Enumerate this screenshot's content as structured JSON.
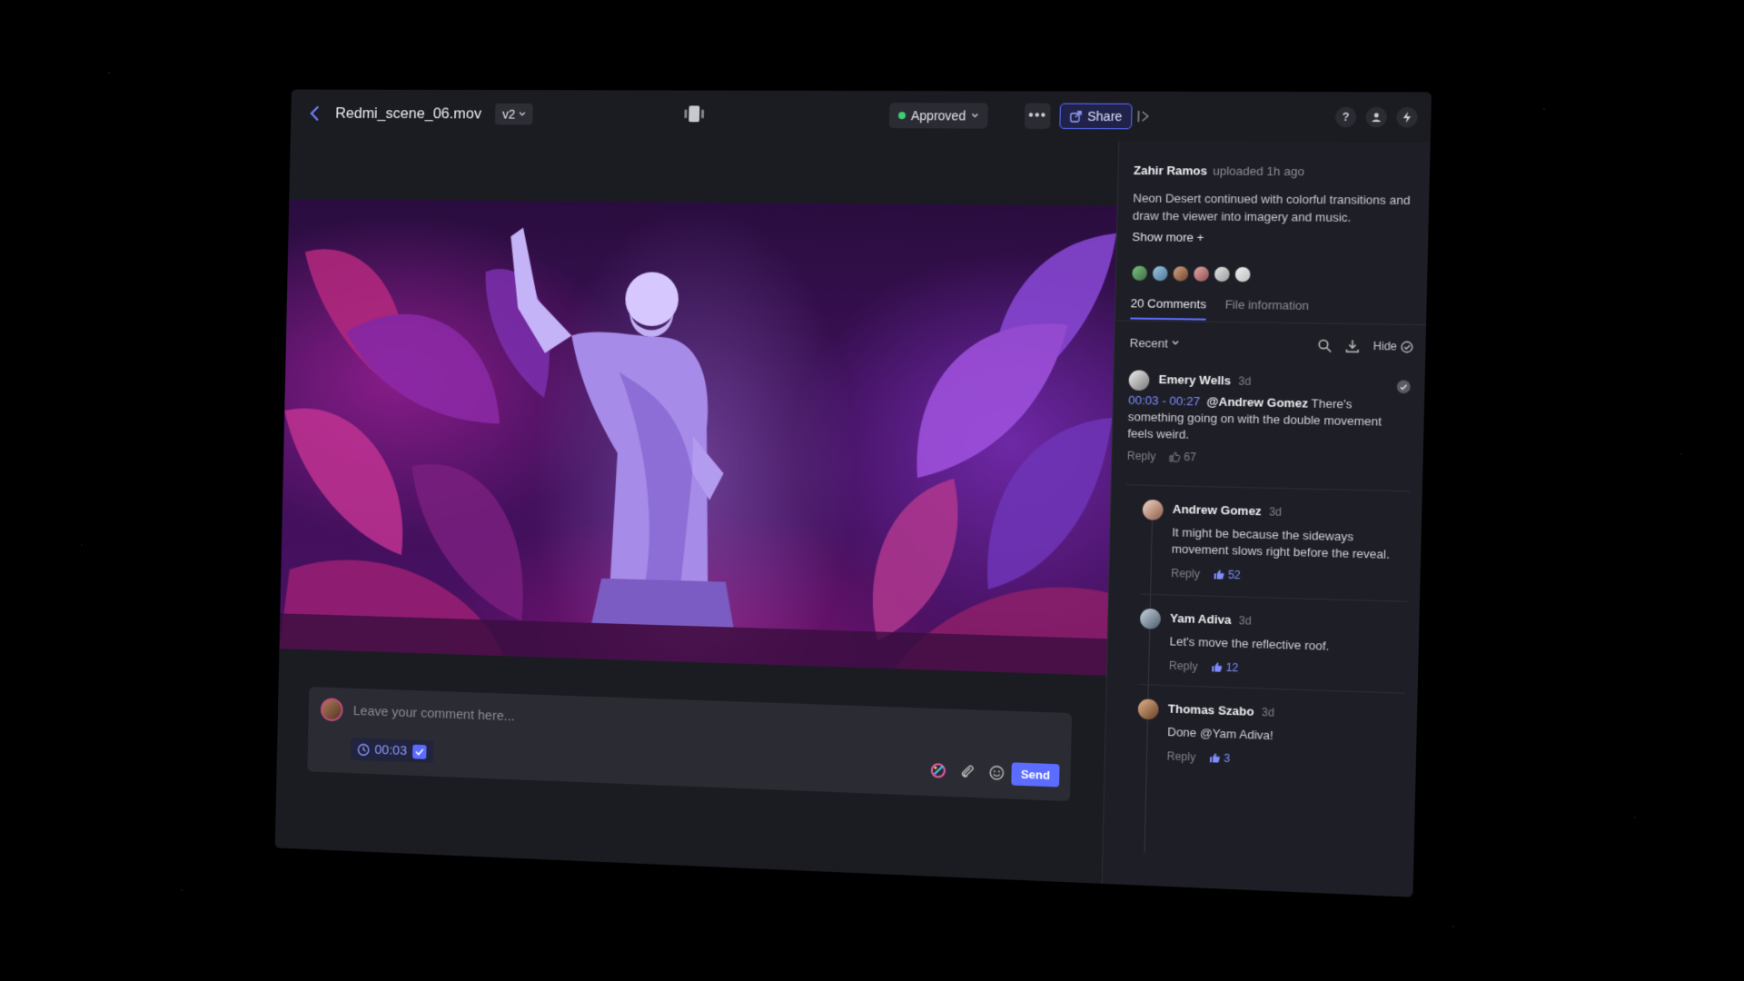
{
  "header": {
    "file_name": "Redmi_scene_06.mov",
    "version": "v2",
    "status": "Approved",
    "share_label": "Share",
    "more_label": "•••"
  },
  "composer": {
    "placeholder": "Leave your comment here...",
    "timecode": "00:03",
    "send_label": "Send"
  },
  "sidebar": {
    "uploader": "Zahir Ramos",
    "uploaded": "uploaded 1h ago",
    "description": "Neon Desert continued with colorful transitions and draw the viewer into imagery and music.",
    "show_more": "Show more +",
    "tabs": [
      "20 Comments",
      "File information"
    ],
    "sort": "Recent",
    "hide_label": "Hide"
  },
  "comments": [
    {
      "name": "Emery Wells",
      "time": "3d",
      "range": "00:03 - 00:27",
      "mention": "@Andrew Gomez",
      "text": "There's something going on with the double movement feels weird.",
      "reply": "Reply",
      "likes": "67"
    },
    {
      "name": "Andrew Gomez",
      "time": "3d",
      "text": "It might be because the sideways movement slows right before the reveal.",
      "reply": "Reply",
      "likes": "52"
    },
    {
      "name": "Yam Adiva",
      "time": "3d",
      "text": "Let's move the reflective roof.",
      "reply": "Reply",
      "likes": "12"
    },
    {
      "name": "Thomas Szabo",
      "time": "3d",
      "text": "Done @Yam Adiva!",
      "reply": "Reply",
      "likes": "3"
    }
  ],
  "colors": {
    "accent": "#5b6cff",
    "approved": "#3ecf73",
    "background": "#1b1c22"
  }
}
